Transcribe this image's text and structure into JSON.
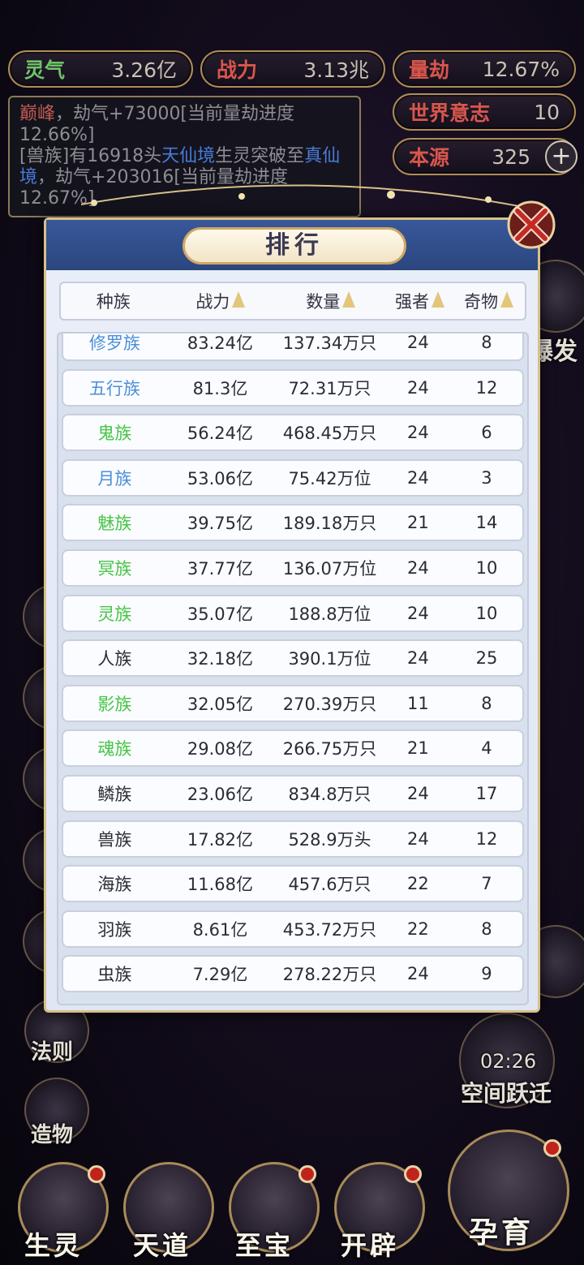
{
  "top_stats": {
    "lingqi": {
      "label": "灵气",
      "value": "3.26亿"
    },
    "zhanli": {
      "label": "战力",
      "value": "3.13兆"
    },
    "liangjie": {
      "label": "量劫",
      "value": "12.67%"
    },
    "shijie": {
      "label": "世界意志",
      "value": "10"
    },
    "benyuan": {
      "label": "本源",
      "value": "325"
    }
  },
  "log": {
    "line1_name": "巅峰",
    "line1_text": "，劫气+73000[当前量劫进度12.66%]",
    "line2_a": "[兽族]有16918头",
    "line2_realm1": "天仙境",
    "line2_b": "生灵突破至",
    "line2_realm2": "真仙境",
    "line2_c": "，劫气+203016[当前量劫进度12.67%]"
  },
  "side": {
    "fa_ze": "法则",
    "zao_wu": "造物",
    "timer": "02:26",
    "kongjian": "空间跃迁",
    "partial_right": "爆发"
  },
  "bottom": {
    "sheng_ling": "生灵",
    "tian_dao": "天道",
    "zhi_bao": "至宝",
    "kai_pi": "开辟",
    "yun_yu": "孕育"
  },
  "modal": {
    "title": "排行",
    "columns": {
      "race": "种族",
      "power": "战力",
      "count": "数量",
      "strong": "强者",
      "relic": "奇物"
    },
    "rows": [
      {
        "race": "修罗族",
        "power": "83.24亿",
        "count": "137.34万只",
        "strong": "24",
        "relic": "8",
        "color": "blue"
      },
      {
        "race": "五行族",
        "power": "81.3亿",
        "count": "72.31万只",
        "strong": "24",
        "relic": "12",
        "color": "blue"
      },
      {
        "race": "鬼族",
        "power": "56.24亿",
        "count": "468.45万只",
        "strong": "24",
        "relic": "6",
        "color": "green"
      },
      {
        "race": "月族",
        "power": "53.06亿",
        "count": "75.42万位",
        "strong": "24",
        "relic": "3",
        "color": "blue"
      },
      {
        "race": "魅族",
        "power": "39.75亿",
        "count": "189.18万只",
        "strong": "21",
        "relic": "14",
        "color": "green"
      },
      {
        "race": "冥族",
        "power": "37.77亿",
        "count": "136.07万位",
        "strong": "24",
        "relic": "10",
        "color": "green"
      },
      {
        "race": "灵族",
        "power": "35.07亿",
        "count": "188.8万位",
        "strong": "24",
        "relic": "10",
        "color": "green"
      },
      {
        "race": "人族",
        "power": "32.18亿",
        "count": "390.1万位",
        "strong": "24",
        "relic": "25",
        "color": "dark"
      },
      {
        "race": "影族",
        "power": "32.05亿",
        "count": "270.39万只",
        "strong": "11",
        "relic": "8",
        "color": "green"
      },
      {
        "race": "魂族",
        "power": "29.08亿",
        "count": "266.75万只",
        "strong": "21",
        "relic": "4",
        "color": "green"
      },
      {
        "race": "鳞族",
        "power": "23.06亿",
        "count": "834.8万只",
        "strong": "24",
        "relic": "17",
        "color": "dark"
      },
      {
        "race": "兽族",
        "power": "17.82亿",
        "count": "528.9万头",
        "strong": "24",
        "relic": "12",
        "color": "dark"
      },
      {
        "race": "海族",
        "power": "11.68亿",
        "count": "457.6万只",
        "strong": "22",
        "relic": "7",
        "color": "dark"
      },
      {
        "race": "羽族",
        "power": "8.61亿",
        "count": "453.72万只",
        "strong": "22",
        "relic": "8",
        "color": "dark"
      },
      {
        "race": "虫族",
        "power": "7.29亿",
        "count": "278.22万只",
        "strong": "24",
        "relic": "9",
        "color": "dark"
      }
    ]
  }
}
